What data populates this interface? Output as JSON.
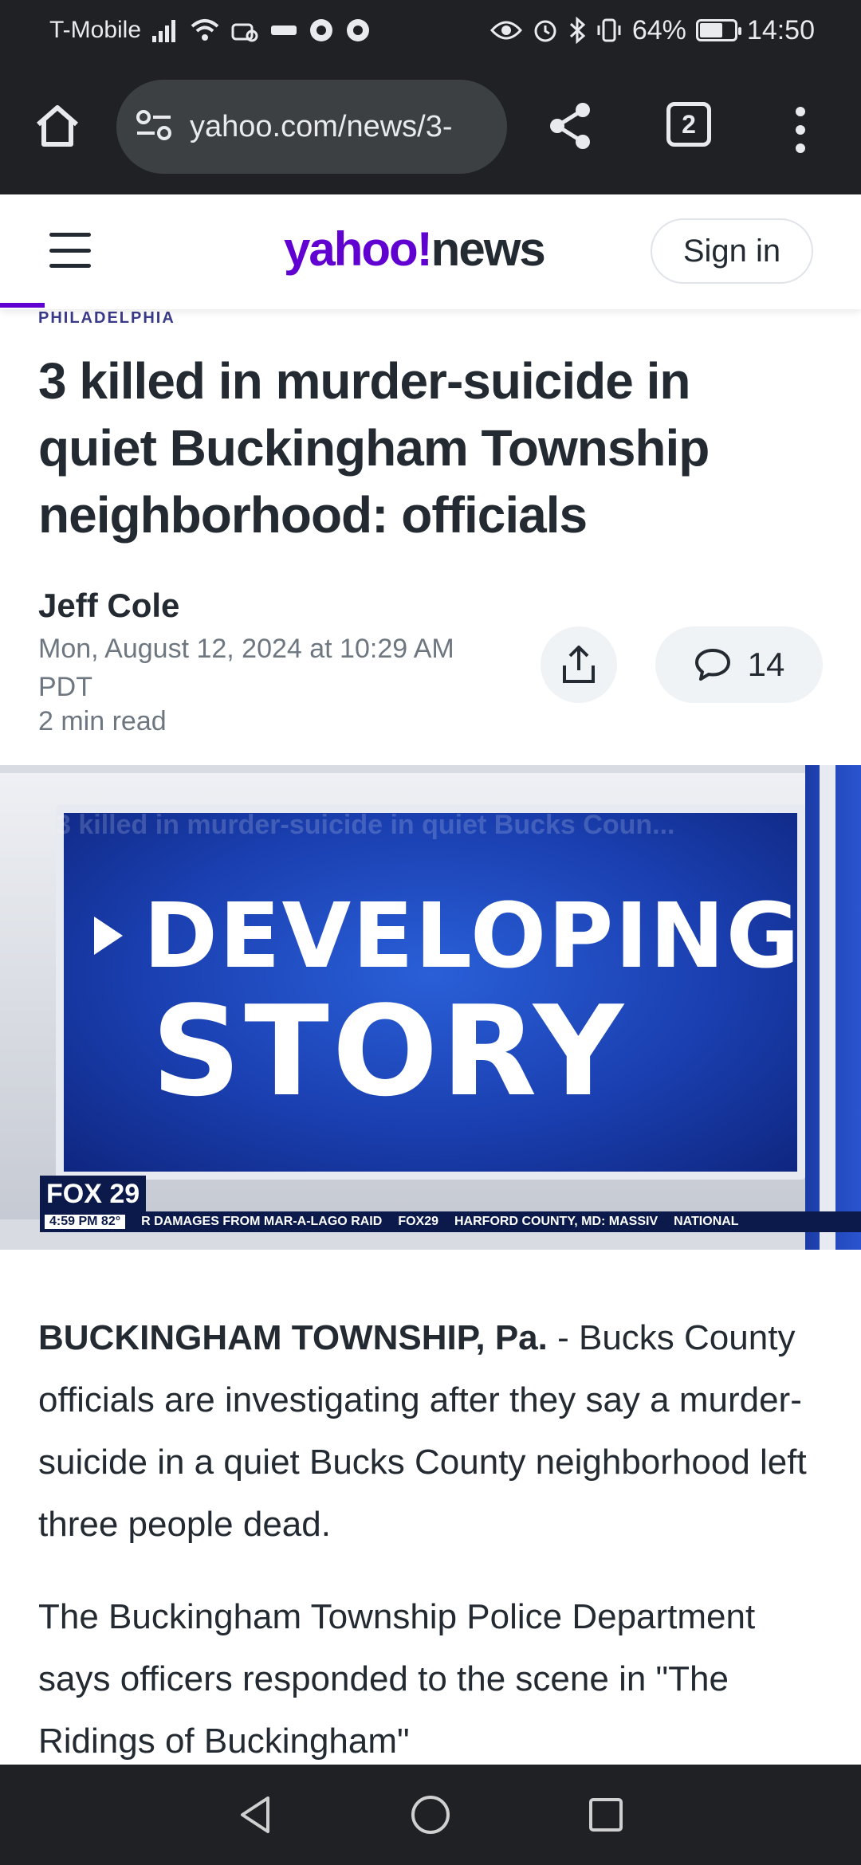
{
  "status_bar": {
    "carrier": "T-Mobile",
    "battery": "64%",
    "battery_level": 0.64,
    "time": "14:50"
  },
  "browser": {
    "url": "yahoo.com/news/3-",
    "tab_count": "2"
  },
  "site": {
    "logo_yahoo": "yahoo!",
    "logo_news": "news",
    "sign_in": "Sign in",
    "brand_color": "#6001d2"
  },
  "article": {
    "source": "PHILADELPHIA",
    "headline": "3 killed in murder-suicide in quiet Buckingham Township neighborhood: officials",
    "author": "Jeff Cole",
    "date": "Mon, August 12, 2024 at 10:29 AM PDT",
    "read_time": "2 min read",
    "comment_count": "14"
  },
  "media": {
    "overlay_title": "3 killed in murder-suicide in quiet Bucks Coun...",
    "banner_line1": "DEVELOPING",
    "banner_line2": "STORY",
    "channel": "FOX 29",
    "ticker_time": "4:59 PM  82°",
    "ticker_text_1": "R DAMAGES FROM MAR-A-LAGO RAID",
    "ticker_channel": "FOX29",
    "ticker_text_2": "HARFORD COUNTY, MD: MASSIV",
    "ticker_tag": "NATIONAL"
  },
  "body": {
    "dateline": "BUCKINGHAM TOWNSHIP, Pa.",
    "para1": " - Bucks County officials are investigating after they say a murder-suicide in a quiet Bucks County neighborhood left three people dead.",
    "para2": "The Buckingham Township Police Department says officers responded to the scene in \"The Ridings of Buckingham\""
  }
}
